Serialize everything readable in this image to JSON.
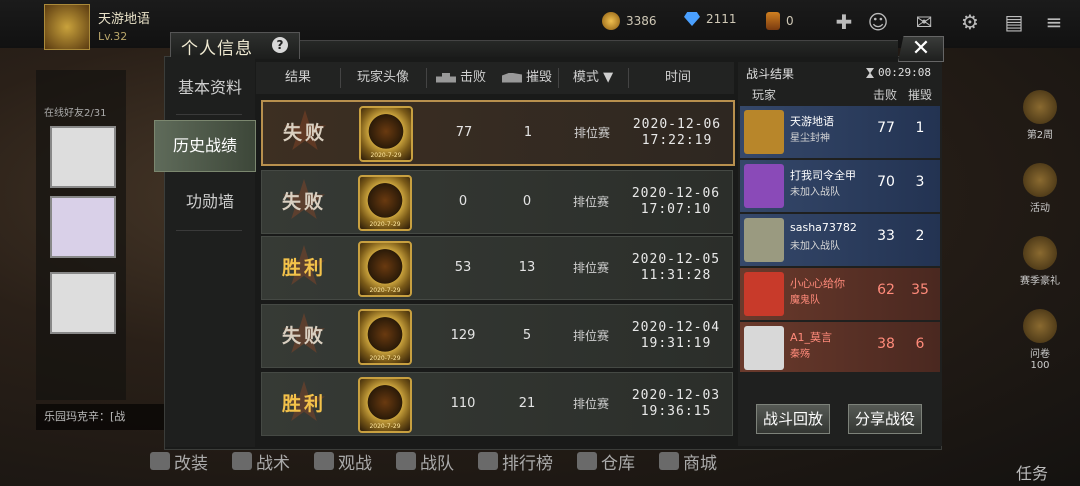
{
  "player": {
    "name": "天游地语",
    "level": "Lv.32"
  },
  "currency": {
    "coins": "3386",
    "gems": "2111",
    "medals": "0"
  },
  "modal": {
    "title": "个人信息",
    "help": "?",
    "close": "✕",
    "nav": [
      "基本资料",
      "历史战绩",
      "功勋墙"
    ],
    "active_nav": 1
  },
  "table": {
    "headers": {
      "result": "结果",
      "avatar": "玩家头像",
      "kills": "击败",
      "destroy": "摧毁",
      "mode": "模式",
      "time": "时间"
    },
    "mode_arrow": "▼",
    "rows": [
      {
        "result": "失败",
        "kind": "lose",
        "avatar_date": "2020-7-29",
        "kills": "77",
        "destroy": "1",
        "mode": "排位赛",
        "date": "2020-12-06",
        "clock": "17:22:19"
      },
      {
        "result": "失败",
        "kind": "lose",
        "avatar_date": "2020-7-29",
        "kills": "0",
        "destroy": "0",
        "mode": "排位赛",
        "date": "2020-12-06",
        "clock": "17:07:10"
      },
      {
        "result": "胜利",
        "kind": "win",
        "avatar_date": "2020-7-29",
        "kills": "53",
        "destroy": "13",
        "mode": "排位赛",
        "date": "2020-12-05",
        "clock": "11:31:28"
      },
      {
        "result": "失败",
        "kind": "lose",
        "avatar_date": "2020-7-29",
        "kills": "129",
        "destroy": "5",
        "mode": "排位赛",
        "date": "2020-12-04",
        "clock": "19:31:19"
      },
      {
        "result": "胜利",
        "kind": "win",
        "avatar_date": "2020-7-29",
        "kills": "110",
        "destroy": "21",
        "mode": "排位赛",
        "date": "2020-12-03",
        "clock": "19:36:15"
      }
    ]
  },
  "battle": {
    "title": "战斗结果",
    "timer": "00:29:08",
    "headers": {
      "player": "玩家",
      "kills": "击败",
      "destroy": "摧毁"
    },
    "players": [
      {
        "name": "天游地语",
        "clan": "星尘封神",
        "kills": "77",
        "destroy": "1",
        "team": "blue",
        "avatar_color": "#b8862a"
      },
      {
        "name": "打我司令全甲",
        "clan": "未加入战队",
        "kills": "70",
        "destroy": "3",
        "team": "blue",
        "avatar_color": "#8a4ab8"
      },
      {
        "name": "sasha73782",
        "clan": "未加入战队",
        "kills": "33",
        "destroy": "2",
        "team": "blue",
        "avatar_color": "#9a9a80"
      },
      {
        "name": "小心心给你",
        "clan": "魔鬼队",
        "kills": "62",
        "destroy": "35",
        "team": "red",
        "avatar_color": "#c83a2a"
      },
      {
        "name": "A1_莫言",
        "clan": "秦殇",
        "kills": "38",
        "destroy": "6",
        "team": "red",
        "avatar_color": "#d8d8d8"
      }
    ],
    "replay": "战斗回放",
    "share": "分享战役"
  },
  "background": {
    "left_caption": "在线好友2/31",
    "chat": "乐园玛克辛：[战",
    "right_items": [
      "第2周",
      "活动",
      "赛季豪礼",
      "问卷"
    ],
    "right_count": "100",
    "task": "任务",
    "nav": [
      "改装",
      "战术",
      "观战",
      "战队",
      "排行榜",
      "仓库",
      "商城"
    ]
  },
  "colors": {
    "win": "#f3c24a",
    "lose": "#d9cfc0",
    "selected_border": "#b8904e",
    "blue_team": "#35486a",
    "red_team": "#6a3a2c"
  }
}
